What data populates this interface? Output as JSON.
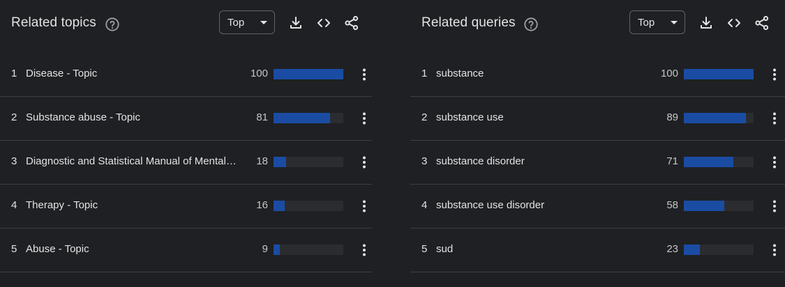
{
  "colors": {
    "background": "#1f2023",
    "bar": "#1a4ca3",
    "bar_track": "#2b2c30",
    "divider": "#3c4043",
    "text": "#e3e3e3"
  },
  "icons": {
    "help": "help-circle-icon",
    "download": "download-icon",
    "embed": "code-icon",
    "share": "share-icon",
    "more": "more-vert-icon",
    "caret": "caret-down-icon"
  },
  "related_topics": {
    "title": "Related topics",
    "filter": "Top",
    "rows": [
      {
        "rank": "1",
        "label": "Disease - Topic",
        "value": "100",
        "fraction": 1.0
      },
      {
        "rank": "2",
        "label": "Substance abuse - Topic",
        "value": "81",
        "fraction": 0.81
      },
      {
        "rank": "3",
        "label": "Diagnostic and Statistical Manual of Mental…",
        "value": "18",
        "fraction": 0.18
      },
      {
        "rank": "4",
        "label": "Therapy - Topic",
        "value": "16",
        "fraction": 0.16
      },
      {
        "rank": "5",
        "label": "Abuse - Topic",
        "value": "9",
        "fraction": 0.09
      }
    ]
  },
  "related_queries": {
    "title": "Related queries",
    "filter": "Top",
    "rows": [
      {
        "rank": "1",
        "label": "substance",
        "value": "100",
        "fraction": 1.0
      },
      {
        "rank": "2",
        "label": "substance use",
        "value": "89",
        "fraction": 0.89
      },
      {
        "rank": "3",
        "label": "substance disorder",
        "value": "71",
        "fraction": 0.71
      },
      {
        "rank": "4",
        "label": "substance use disorder",
        "value": "58",
        "fraction": 0.58
      },
      {
        "rank": "5",
        "label": "sud",
        "value": "23",
        "fraction": 0.23
      }
    ]
  }
}
